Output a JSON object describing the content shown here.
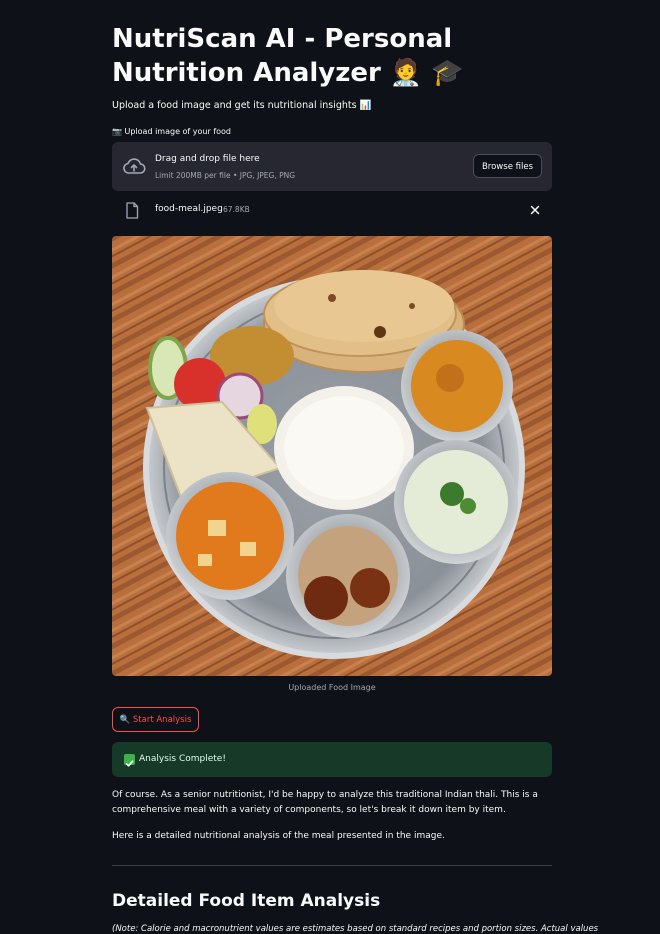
{
  "header": {
    "title": "NutriScan AI - Personal Nutrition Analyzer 🧑‍⚕️ 🎓",
    "subtitle": "Upload a food image and get its nutritional insights 📊"
  },
  "uploader": {
    "label": "📷 Upload image of your food",
    "drop_title": "Drag and drop file here",
    "limit_text": "Limit 200MB per file • JPG, JPEG, PNG",
    "browse_label": "Browse files",
    "icon": "cloud-upload-icon"
  },
  "file": {
    "name": "food-meal.jpeg",
    "size": "67.8KB",
    "icon": "file-icon"
  },
  "image": {
    "caption": "Uploaded Food Image"
  },
  "actions": {
    "analyze_label": "🔍 Start Analysis",
    "accent": "#ff4b4b"
  },
  "status": {
    "text": "Analysis Complete!",
    "color": "#173928"
  },
  "result": {
    "intro": "Of course. As a senior nutritionist, I'd be happy to analyze this traditional Indian thali. This is a comprehensive meal with a variety of components, so let's break it down item by item.",
    "lead": "Here is a detailed nutritional analysis of the meal presented in the image.",
    "section_title": "Detailed Food Item Analysis",
    "note": "(Note: Calorie and macronutrient values are estimates based on standard recipes and portion sizes. Actual values"
  }
}
